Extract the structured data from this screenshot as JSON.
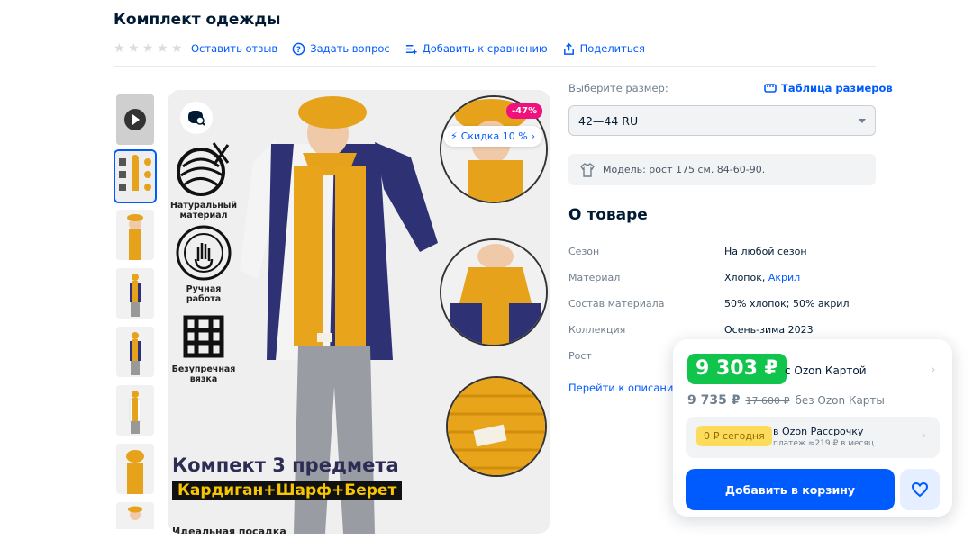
{
  "product": {
    "title": "Комплект одежды"
  },
  "actions": {
    "review": "Оставить отзыв",
    "question": "Задать вопрос",
    "compare": "Добавить к сравнению",
    "share": "Поделиться"
  },
  "image": {
    "features": [
      "Натуральный материал",
      "Ручная работа",
      "Безупречная вязка"
    ],
    "discount_badge": "-47%",
    "sale_chip": "Скидка 10 %",
    "headline": "Компект 3 предмета",
    "subline": "Кардиган+Шарф+Берет",
    "foot": "Идеальная посадка"
  },
  "size": {
    "label": "Выберите размер:",
    "table_link": "Таблица размеров",
    "selected": "42—44 RU",
    "model_info": "Модель: рост 175 см. 84-60-90."
  },
  "about": {
    "title": "О товаре",
    "specs": [
      {
        "k": "Сезон",
        "v": "На любой сезон"
      },
      {
        "k": "Материал",
        "v": "Хлопок, ",
        "link": "Акрил"
      },
      {
        "k": "Состав материала",
        "v": "50% хлопок; 50% акрил"
      },
      {
        "k": "Коллекция",
        "v": "Осень-зима 2023"
      },
      {
        "k": "Рост",
        "v": ""
      }
    ],
    "desc_link": "Перейти к описанию"
  },
  "price": {
    "card_price": "9 303 ₽",
    "card_label": "с Ozon Картой",
    "regular_price": "9 735 ₽",
    "old_price": "17 600 ₽",
    "regular_label": "без Ozon Карты",
    "installment_btn": "0 ₽ сегодня",
    "installment_title": "в Ozon Рассрочку",
    "installment_sub": "платеж ≈219 ₽ в месяц",
    "cart_button": "Добавить в корзину"
  },
  "colors": {
    "brand": "#005bff",
    "green": "#10c44c",
    "mustard": "#e6a21a",
    "navy": "#2e3275"
  }
}
